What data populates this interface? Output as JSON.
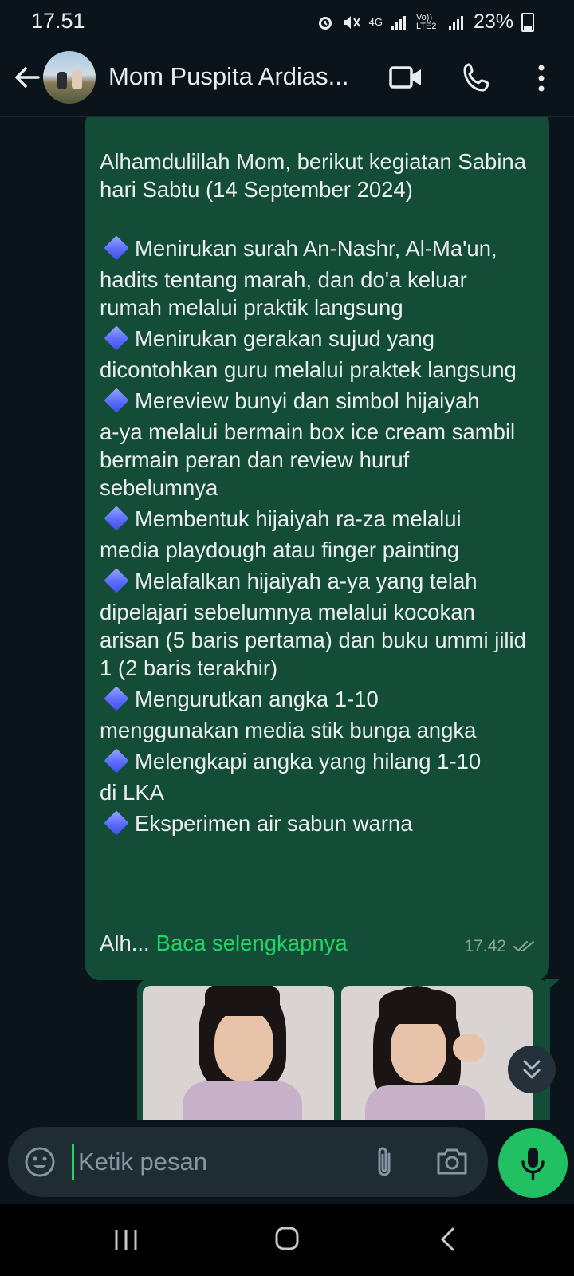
{
  "status_bar": {
    "time": "17.51",
    "network_4g": "4G",
    "volte": "Vo)) LTE2",
    "battery": "23%"
  },
  "header": {
    "contact_name": "Mom Puspita Ardias...",
    "icons": [
      "back-arrow-icon",
      "video-call-icon",
      "phone-icon",
      "more-vert-icon"
    ]
  },
  "message": {
    "intro": "Alhamdulillah Mom, berikut kegiatan Sabina hari Sabtu (14 September 2024)",
    "items": [
      {
        "first": "Menirukan surah An-Nashr, Al-Ma'un,",
        "rest": "hadits tentang marah, dan do'a keluar rumah melalui praktik langsung"
      },
      {
        "first": "Menirukan gerakan sujud yang",
        "rest": "dicontohkan guru melalui praktek langsung"
      },
      {
        "first": "Mereview bunyi dan simbol hijaiyah",
        "rest": "a-ya melalui bermain box ice cream sambil bermain peran dan review huruf sebelumnya"
      },
      {
        "first": "Membentuk hijaiyah ra-za melalui",
        "rest": "media playdough atau finger painting"
      },
      {
        "first": "Melafalkan hijaiyah a-ya yang telah",
        "rest": "dipelajari sebelumnya melalui kocokan arisan (5 baris pertama) dan buku ummi jilid 1 (2 baris terakhir)"
      },
      {
        "first": "Mengurutkan angka 1-10",
        "rest": "menggunakan media stik bunga angka"
      },
      {
        "first": "Melengkapi angka yang hilang 1-10",
        "rest": "di LKA"
      },
      {
        "first": "Eksperimen air sabun warna",
        "rest": ""
      }
    ],
    "truncated_prefix": "Alh...",
    "read_more": "Baca selengkapnya",
    "time": "17.42",
    "status_icon": "double-check-icon"
  },
  "composer": {
    "placeholder": "Ketik pesan"
  },
  "colors": {
    "background": "#0b141a",
    "outgoing_bubble": "#134d37",
    "accent_green": "#25d366",
    "mic_button": "#21c063"
  }
}
